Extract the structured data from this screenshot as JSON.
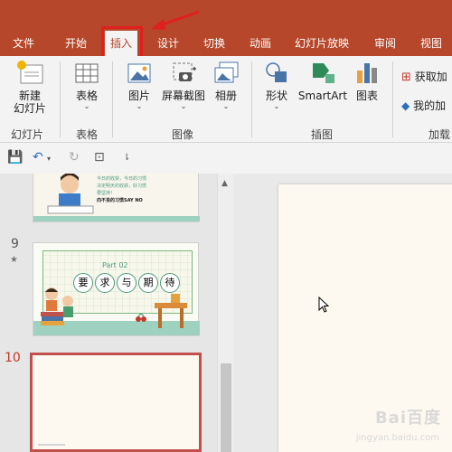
{
  "tabs": [
    {
      "label": "文件",
      "active": false
    },
    {
      "label": "开始",
      "active": false
    },
    {
      "label": "插入",
      "active": true
    },
    {
      "label": "设计",
      "active": false
    },
    {
      "label": "切换",
      "active": false
    },
    {
      "label": "动画",
      "active": false
    },
    {
      "label": "幻灯片放映",
      "active": false
    },
    {
      "label": "审阅",
      "active": false
    },
    {
      "label": "视图",
      "active": false
    }
  ],
  "ribbon": {
    "new_slide": {
      "line1": "新建",
      "line2": "幻灯片"
    },
    "table": "表格",
    "picture": "图片",
    "screenshot": "屏幕截图",
    "album": "相册",
    "shapes": "形状",
    "smartart": "SmartArt",
    "chart": "图表",
    "get_addins": "获取加",
    "my_addins": "我的加",
    "groups": {
      "slides": "幻灯片",
      "tables": "表格",
      "images": "图像",
      "illustrations": "插图",
      "addins": "加载"
    }
  },
  "slides": {
    "num9": "9",
    "star": "★",
    "num10": "10",
    "thumb8": {
      "line1": "今日的收获，今日的习惯",
      "line2": "决定明天的收获，好习惯",
      "line3": "要坚持！",
      "line4": "向不良的习惯SAY NO"
    },
    "thumb9": {
      "part": "Part 02",
      "chars": [
        "要",
        "求",
        "与",
        "期",
        "待"
      ]
    }
  },
  "watermark": {
    "logo": "Bai百度",
    "sub": "jingyan.baidu.com"
  },
  "colors": {
    "accent": "#b7472a",
    "highlight": "#e01f1f",
    "slide_border": "#c0504d"
  }
}
